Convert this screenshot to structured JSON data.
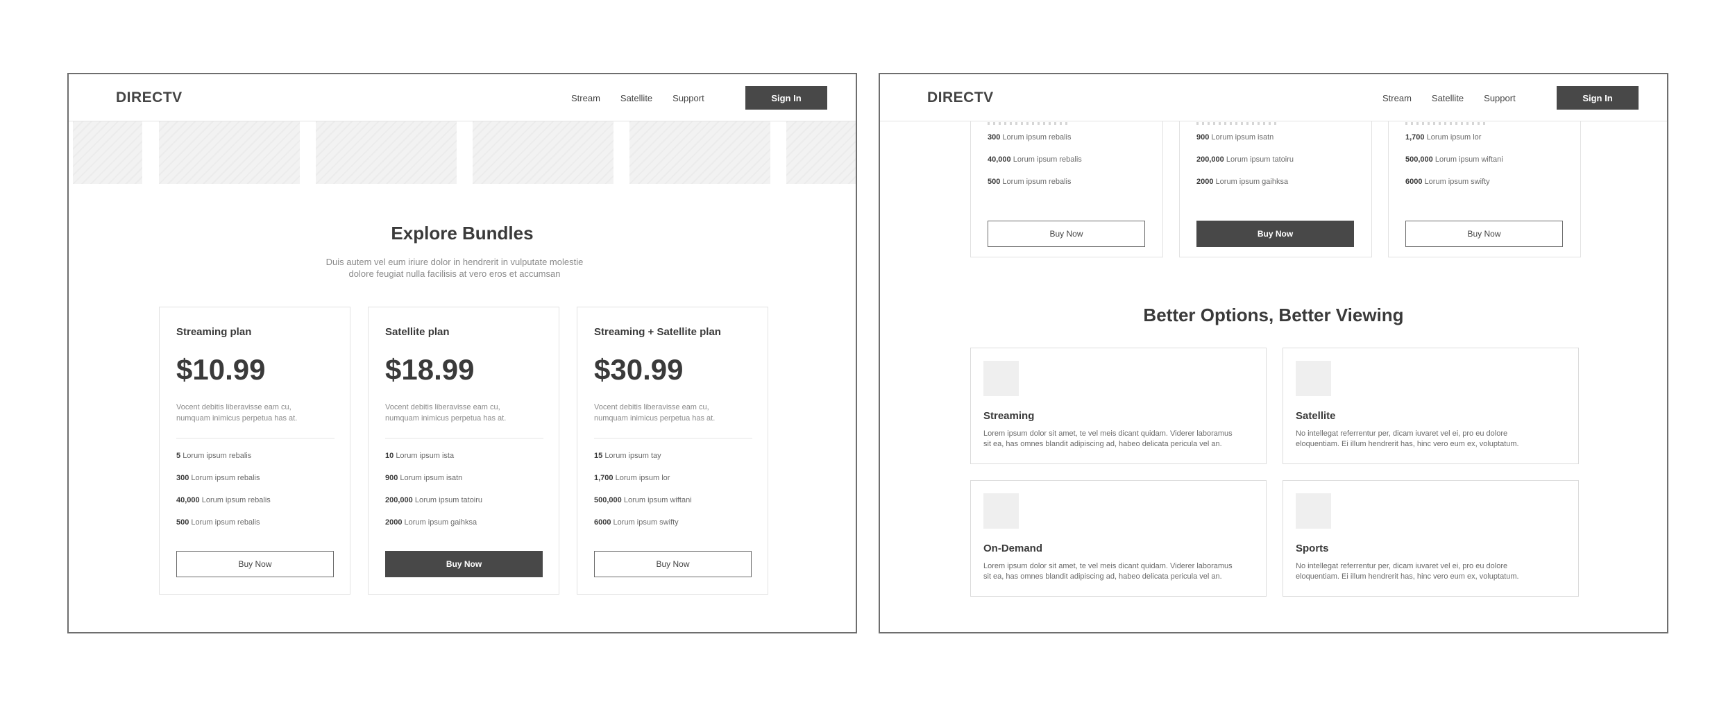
{
  "nav": {
    "logo": "DIRECTV",
    "links": [
      "Stream",
      "Satellite",
      "Support"
    ],
    "sign_in": "Sign In"
  },
  "bundles": {
    "title": "Explore Bundles",
    "subtitle_line1": "Duis autem vel eum iriure dolor in hendrerit in vulputate molestie",
    "subtitle_line2": "dolore feugiat nulla facilisis at vero eros et accumsan"
  },
  "plans": [
    {
      "name": "Streaming plan",
      "price": "$10.99",
      "desc_line1": "Vocent debitis liberavisse eam cu,",
      "desc_line2": "numquam inimicus perpetua has at.",
      "features": [
        {
          "num": "5",
          "text": "Lorum ipsum rebalis"
        },
        {
          "num": "300",
          "text": "Lorum ipsum rebalis"
        },
        {
          "num": "40,000",
          "text": "Lorum ipsum rebalis"
        },
        {
          "num": "500",
          "text": "Lorum ipsum rebalis"
        }
      ],
      "button": "Buy Now",
      "highlighted": false
    },
    {
      "name": "Satellite plan",
      "price": "$18.99",
      "desc_line1": "Vocent debitis liberavisse eam cu,",
      "desc_line2": "numquam inimicus perpetua has at.",
      "features": [
        {
          "num": "10",
          "text": "Lorum ipsum ista"
        },
        {
          "num": "900",
          "text": "Lorum ipsum isatn"
        },
        {
          "num": "200,000",
          "text": "Lorum ipsum tatoiru"
        },
        {
          "num": "2000",
          "text": "Lorum ipsum gaihksa"
        }
      ],
      "button": "Buy Now",
      "highlighted": true
    },
    {
      "name": "Streaming + Satellite plan",
      "price": "$30.99",
      "desc_line1": "Vocent debitis liberavisse eam cu,",
      "desc_line2": "numquam inimicus perpetua has at.",
      "features": [
        {
          "num": "15",
          "text": "Lorum ipsum tay"
        },
        {
          "num": "1,700",
          "text": "Lorum ipsum lor"
        },
        {
          "num": "500,000",
          "text": "Lorum ipsum wiftani"
        },
        {
          "num": "6000",
          "text": "Lorum ipsum swifty"
        }
      ],
      "button": "Buy Now",
      "highlighted": false
    }
  ],
  "options": {
    "title": "Better Options, Better Viewing",
    "cards": [
      {
        "title": "Streaming",
        "line1": "Lorem ipsum dolor sit amet, te vel meis dicant quidam. Viderer laboramus",
        "line2": "sit ea, has omnes blandit adipiscing ad, habeo delicata pericula vel an."
      },
      {
        "title": "Satellite",
        "line1": "No intellegat referrentur per, dicam iuvaret vel ei, pro eu dolore",
        "line2": "eloquentiam. Ei illum hendrerit has, hinc vero eum ex, voluptatum."
      },
      {
        "title": "On-Demand",
        "line1": "Lorem ipsum dolor sit amet, te vel meis dicant quidam. Viderer laboramus",
        "line2": "sit ea, has omnes blandit adipiscing ad, habeo delicata pericula vel an."
      },
      {
        "title": "Sports",
        "line1": "No intellegat referrentur per, dicam iuvaret vel ei, pro eu dolore",
        "line2": "eloquentiam. Ei illum hendrerit has, hinc vero eum ex, voluptatum."
      }
    ]
  },
  "colors": {
    "button_dark": "#484848",
    "frame_border": "#6e6e6e",
    "text_dark": "#3a3a3a",
    "text_muted": "#8a8a8a"
  }
}
